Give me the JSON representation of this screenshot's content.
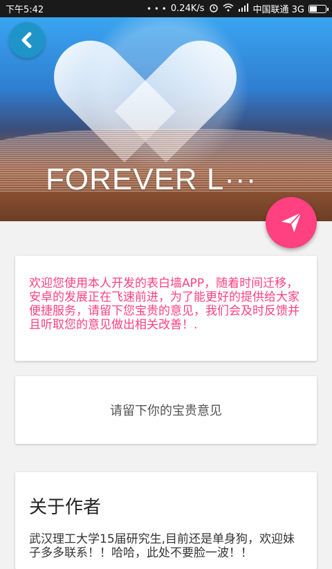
{
  "status_bar": {
    "time": "下午5:42",
    "dots": "• • •",
    "network_speed": "0.24K/s",
    "alarm_icon": "alarm-icon",
    "wifi_icon": "wifi-icon",
    "signal_icon": "signal-icon",
    "carrier": "中国联通 3G",
    "battery_icon": "battery-icon"
  },
  "header": {
    "title": "FOREVER L···",
    "back_icon": "chevron-left-icon",
    "back_color": "#1f94c9"
  },
  "fab": {
    "icon": "send-icon",
    "color": "#ff4081"
  },
  "intro_card": {
    "text": "欢迎您使用本人开发的表白墙APP，随着时间迁移，安卓的发展正在飞速前进，为了能更好的提供给大家便捷服务，请留下您宝贵的意见，我们会及时反馈并且听取您的意见做出相关改善！."
  },
  "feedback_card": {
    "label": "请留下你的宝贵意见"
  },
  "about_card": {
    "title": "关于作者",
    "text": "武汉理工大学15届研究生,目前还是单身狗，欢迎妹子多多联系！！哈哈，此处不要脸一波！！"
  }
}
